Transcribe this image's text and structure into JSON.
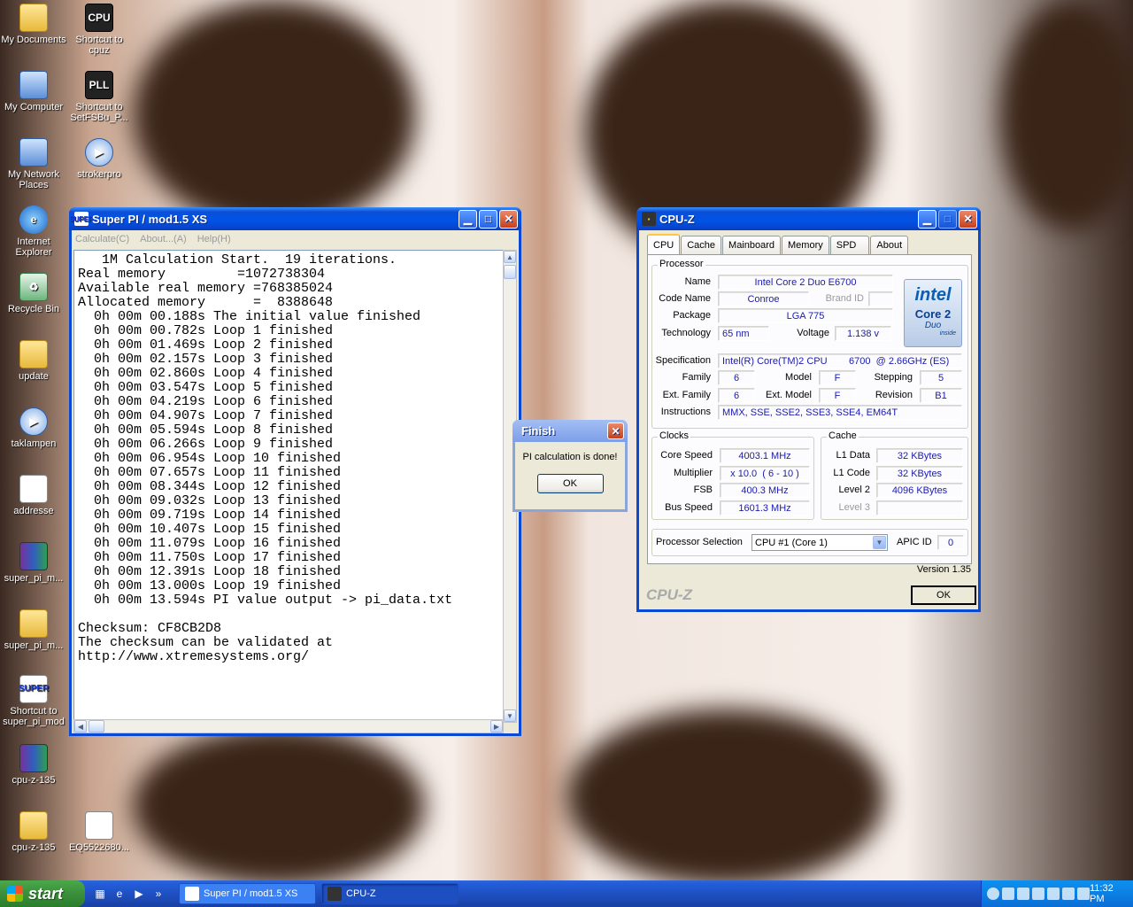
{
  "desktop": {
    "icons": [
      {
        "label": "My Documents",
        "glyph": "",
        "kind": "folder"
      },
      {
        "label": "Shortcut to cpuz",
        "glyph": "CPU",
        "kind": "app"
      },
      {
        "label": "My Computer",
        "glyph": "",
        "kind": "pc"
      },
      {
        "label": "Shortcut to SetFSBu_P...",
        "glyph": "PLL",
        "kind": "app"
      },
      {
        "label": "My Network Places",
        "glyph": "",
        "kind": "pc"
      },
      {
        "label": "strokerpro",
        "glyph": "▶",
        "kind": "media"
      },
      {
        "label": "Internet Explorer",
        "glyph": "e",
        "kind": "ie"
      },
      {
        "label": "Recycle Bin",
        "glyph": "♻",
        "kind": "bin"
      },
      {
        "label": "update",
        "glyph": "",
        "kind": "folder"
      },
      {
        "label": "taklampen",
        "glyph": "▶",
        "kind": "media"
      },
      {
        "label": "addresse",
        "glyph": "",
        "kind": "doc"
      },
      {
        "label": "super_pi_m...",
        "glyph": "",
        "kind": "rar"
      },
      {
        "label": "super_pi_m...",
        "glyph": "",
        "kind": "folder"
      },
      {
        "label": "Shortcut to super_pi_mod",
        "glyph": "SUPER",
        "kind": "super"
      },
      {
        "label": "cpu-z-135",
        "glyph": "",
        "kind": "rar"
      },
      {
        "label": "cpu-z-135",
        "glyph": "",
        "kind": "folder"
      },
      {
        "label": "EQ5522680...",
        "glyph": "",
        "kind": "doc"
      }
    ]
  },
  "superpi": {
    "title": "Super PI / mod1.5 XS",
    "icon_text": "SUPER",
    "menu": [
      "Calculate(C)",
      "About...(A)",
      "Help(H)"
    ],
    "lines": [
      "   1M Calculation Start.  19 iterations.",
      "Real memory         =1072738304",
      "Available real memory =768385024",
      "Allocated memory      =  8388648",
      "  0h 00m 00.188s The initial value finished",
      "  0h 00m 00.782s Loop 1 finished",
      "  0h 00m 01.469s Loop 2 finished",
      "  0h 00m 02.157s Loop 3 finished",
      "  0h 00m 02.860s Loop 4 finished",
      "  0h 00m 03.547s Loop 5 finished",
      "  0h 00m 04.219s Loop 6 finished",
      "  0h 00m 04.907s Loop 7 finished",
      "  0h 00m 05.594s Loop 8 finished",
      "  0h 00m 06.266s Loop 9 finished",
      "  0h 00m 06.954s Loop 10 finished",
      "  0h 00m 07.657s Loop 11 finished",
      "  0h 00m 08.344s Loop 12 finished",
      "  0h 00m 09.032s Loop 13 finished",
      "  0h 00m 09.719s Loop 14 finished",
      "  0h 00m 10.407s Loop 15 finished",
      "  0h 00m 11.079s Loop 16 finished",
      "  0h 00m 11.750s Loop 17 finished",
      "  0h 00m 12.391s Loop 18 finished",
      "  0h 00m 13.000s Loop 19 finished",
      "  0h 00m 13.594s PI value output -> pi_data.txt",
      "",
      "Checksum: CF8CB2D8",
      "The checksum can be validated at",
      "http://www.xtremesystems.org/"
    ]
  },
  "finish_dialog": {
    "title": "Finish",
    "message": "PI calculation is done!",
    "ok": "OK"
  },
  "cpuz": {
    "title": "CPU-Z",
    "tabs": [
      "CPU",
      "Cache",
      "Mainboard",
      "Memory",
      "SPD",
      "About"
    ],
    "processor": {
      "group": "Processor",
      "name_label": "Name",
      "name": "Intel Core 2 Duo E6700",
      "codename_label": "Code Name",
      "codename": "Conroe",
      "brandid_label": "Brand ID",
      "package_label": "Package",
      "package": "LGA 775",
      "technology_label": "Technology",
      "technology": "65 nm",
      "voltage_label": "Voltage",
      "voltage": "1.138 v",
      "spec_label": "Specification",
      "spec": "Intel(R) Core(TM)2 CPU        6700  @ 2.66GHz (ES)",
      "family_label": "Family",
      "family": "6",
      "model_label": "Model",
      "model": "F",
      "stepping_label": "Stepping",
      "stepping": "5",
      "extfamily_label": "Ext. Family",
      "extfamily": "6",
      "extmodel_label": "Ext. Model",
      "extmodel": "F",
      "revision_label": "Revision",
      "revision": "B1",
      "instructions_label": "Instructions",
      "instructions": "MMX, SSE, SSE2, SSE3, SSE4, EM64T"
    },
    "logo": {
      "brand": "intel",
      "line1": "Core 2",
      "line2": "Duo",
      "line3": "inside"
    },
    "clocks": {
      "group": "Clocks",
      "core_label": "Core Speed",
      "core": "4003.1 MHz",
      "mult_label": "Multiplier",
      "mult": "x 10.0  ( 6 - 10 )",
      "fsb_label": "FSB",
      "fsb": "400.3 MHz",
      "bus_label": "Bus Speed",
      "bus": "1601.3 MHz"
    },
    "cache": {
      "group": "Cache",
      "l1d_label": "L1 Data",
      "l1d": "32 KBytes",
      "l1c_label": "L1 Code",
      "l1c": "32 KBytes",
      "l2_label": "Level 2",
      "l2": "4096 KBytes",
      "l3_label": "Level 3"
    },
    "selection_label": "Processor Selection",
    "selection": "CPU #1 (Core 1)",
    "apic_label": "APIC ID",
    "apic": "0",
    "version": "Version 1.35",
    "brand_footer": "CPU-Z",
    "ok": "OK"
  },
  "taskbar": {
    "start": "start",
    "tasks": [
      "Super PI / mod1.5 XS",
      "CPU-Z"
    ],
    "clock": "11:32 PM"
  }
}
